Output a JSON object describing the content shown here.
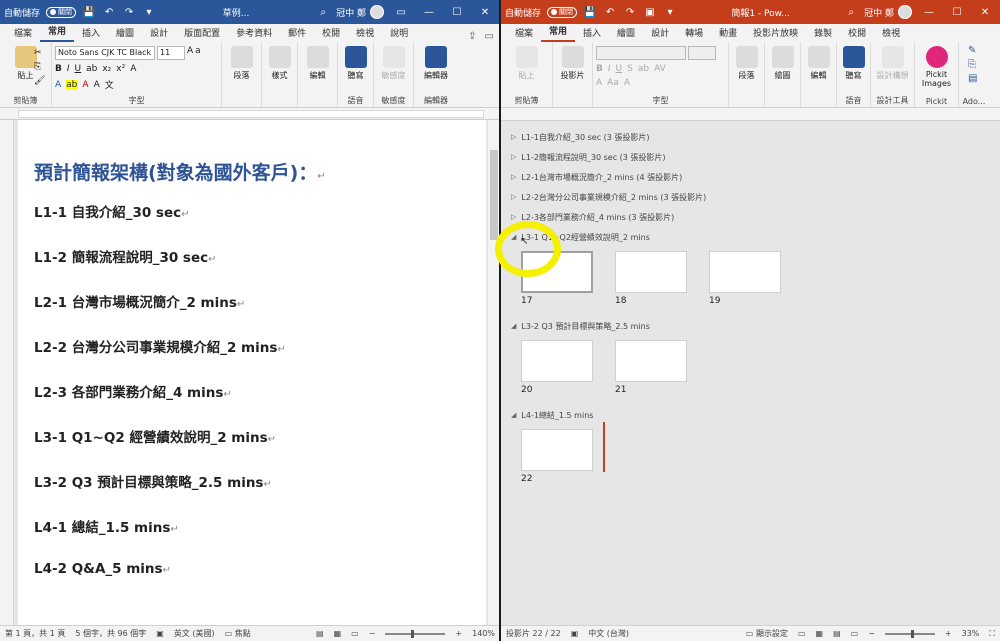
{
  "word": {
    "autosave": "自動儲存",
    "toggle": "關閉",
    "title": "草例...",
    "user": "冠中 鄭",
    "tabs": [
      "檔案",
      "常用",
      "插入",
      "繪圖",
      "設計",
      "版面配置",
      "參考資料",
      "郵件",
      "校閱",
      "檢視",
      "說明"
    ],
    "ribbon": {
      "clipboard": {
        "paste": "貼上",
        "label": "剪貼簿"
      },
      "font": {
        "name": "Noto Sans CJK TC Black",
        "size": "11",
        "label": "字型"
      },
      "paragraph": "段落",
      "styles": "樣式",
      "editing": "編輯",
      "dictate": "聽寫",
      "sensitivity": "敏感度",
      "editor": "編輯器",
      "voice_label": "語音",
      "sens_label": "敏感度",
      "editor_label": "編輯器"
    },
    "doc": {
      "title": "預計簡報架構(對象為國外客戶)：",
      "lines": [
        "L1-1 自我介紹_30 sec",
        "L1-2 簡報流程說明_30 sec",
        "L2-1 台灣市場概況簡介_2 mins",
        "L2-2 台灣分公司事業規模介紹_2 mins",
        "L2-3 各部門業務介紹_4 mins",
        "L3-1 Q1~Q2 經營績效說明_2 mins",
        "L3-2 Q3 預計目標與策略_2.5 mins",
        "L4-1 總結_1.5 mins",
        "L4-2 Q&A_5 mins"
      ]
    },
    "status": {
      "page": "第 1 頁，共 1 頁",
      "words": "5 個字，共 96 個字",
      "lang": "英文 (美國)",
      "focus": "焦點",
      "zoom": "140%"
    }
  },
  "ppt": {
    "autosave": "自動儲存",
    "toggle": "關閉",
    "title": "簡報1 - Pow...",
    "user": "冠中 鄭",
    "tabs": [
      "檔案",
      "常用",
      "插入",
      "繪圖",
      "設計",
      "轉場",
      "動畫",
      "投影片放映",
      "錄製",
      "校閱",
      "檢視"
    ],
    "ribbon": {
      "paste": "貼上",
      "clip_label": "剪貼簿",
      "slides": "投影片",
      "font_label": "字型",
      "paragraph": "段落",
      "drawing": "繪圖",
      "editing": "編輯",
      "dictate": "聽寫",
      "voice_label": "語音",
      "designer": "設計構想",
      "designer_label": "設計工具",
      "pickit": "Pickit Images",
      "pickit_label": "Pickit",
      "addins_label": "Ado..."
    },
    "sections": [
      {
        "name": "L1-1自我介紹_30 sec (3 張投影片)",
        "collapsed": true
      },
      {
        "name": "L1-2簡報流程說明_30 sec (3 張投影片)",
        "collapsed": true
      },
      {
        "name": "L2-1台灣市場概況簡介_2 mins (4 張投影片)",
        "collapsed": true
      },
      {
        "name": "L2-2台灣分公司事業規模介紹_2 mins (3 張投影片)",
        "collapsed": true
      },
      {
        "name": "L2-3各部門業務介紹_4 mins (3 張投影片)",
        "collapsed": true
      },
      {
        "name": "L3-1 Q1~Q2經營績效說明_2 mins",
        "collapsed": false,
        "slides": [
          "17",
          "18",
          "19"
        ]
      },
      {
        "name": "L3-2 Q3 預計目標與策略_2.5 mins",
        "collapsed": false,
        "slides": [
          "20",
          "21"
        ]
      },
      {
        "name": "L4-1總結_1.5 mins",
        "collapsed": false,
        "slides": [
          "22"
        ]
      }
    ],
    "status": {
      "slide": "投影片 22 / 22",
      "lang": "中文 (台灣)",
      "display": "顯示設定",
      "zoom": "33%"
    }
  }
}
